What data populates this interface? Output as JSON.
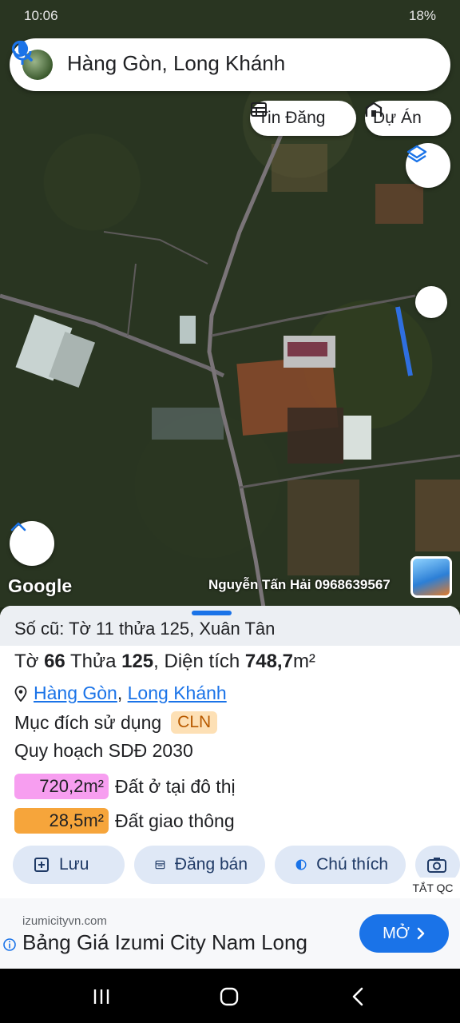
{
  "status_bar": {
    "time": "10:06",
    "right": "18%"
  },
  "search": {
    "query": "Hàng Gòn, Long Khánh"
  },
  "chips": {
    "tin_dang": "Tin Đăng",
    "du_an": "Dự Án"
  },
  "map": {
    "attribution": "Google",
    "watermark": "Nguyễn Tấn Hải 0968639567"
  },
  "parcel": {
    "old_info": "Số cũ: Tờ 11 thửa 125, Xuân Tân",
    "to_label": "Tờ",
    "to_value": "66",
    "thua_label": "Thửa",
    "thua_value": "125",
    "area_label": ", Diện tích",
    "area_value": "748,7",
    "area_unit": "m²",
    "location_commune": "Hàng Gòn",
    "location_sep": ",",
    "location_city": "Long Khánh",
    "purpose_label": "Mục đích sử dụng",
    "purpose_code": "CLN",
    "plan_label": "Quy hoạch SDĐ 2030",
    "planning": [
      {
        "area": "720,2m²",
        "label": "Đất ở tại đô thị",
        "color": "#f79ef0"
      },
      {
        "area": "28,5m²",
        "label": "Đất giao thông",
        "color": "#f6a53b"
      }
    ]
  },
  "actions": {
    "save": "Lưu",
    "post": "Đăng bán",
    "legend": "Chú thích"
  },
  "ad": {
    "hide_label": "TẮT QC",
    "domain": "izumicityvn.com",
    "title": "Bảng Giá Izumi City Nam Long",
    "button": "MỞ"
  },
  "icons": {
    "search": "search-icon",
    "mic": "mic-icon",
    "table": "table-icon",
    "building": "building-icon",
    "layers": "layers-icon",
    "chevron_up": "chevron-up-icon",
    "pin": "location-pin-icon",
    "add": "add-box-icon",
    "post": "list-icon",
    "contrast": "contrast-icon",
    "camera": "camera-icon",
    "info": "info-icon",
    "chevron_right": "chevron-right-icon"
  },
  "colors": {
    "accent": "#1a73e8",
    "highlight_line": "#2f6fe0"
  }
}
